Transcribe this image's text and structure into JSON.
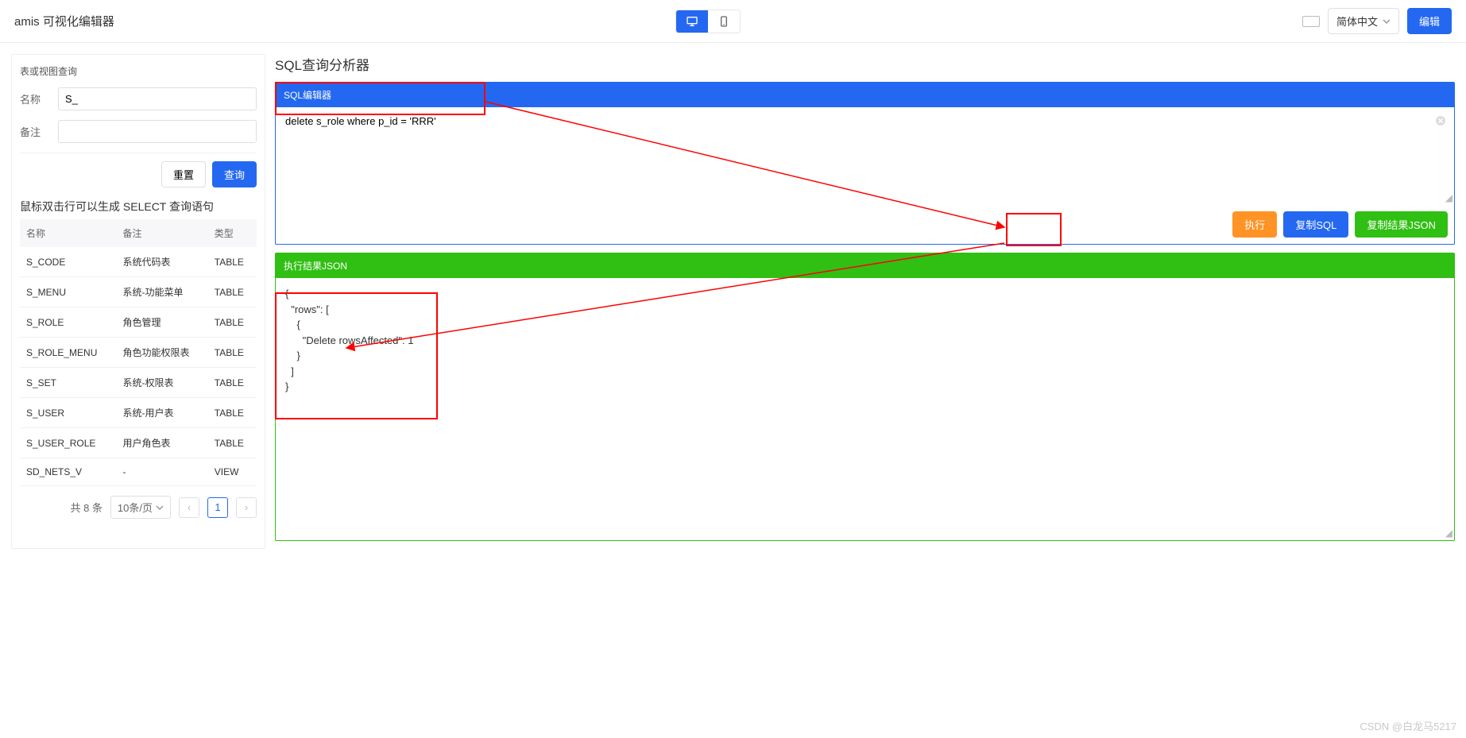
{
  "topbar": {
    "title": "amis 可视化编辑器",
    "lang": "简体中文",
    "edit": "编辑"
  },
  "sidebar": {
    "title": "表或视图查询",
    "name_label": "名称",
    "name_value": "S_",
    "remark_label": "备注",
    "remark_value": "",
    "reset": "重置",
    "query": "查询",
    "hint": "鼠标双击行可以生成 SELECT 查询语句",
    "cols": {
      "name": "名称",
      "remark": "备注",
      "type": "类型"
    },
    "rows": [
      {
        "name": "S_CODE",
        "remark": "系统代码表",
        "type": "TABLE"
      },
      {
        "name": "S_MENU",
        "remark": "系统-功能菜单",
        "type": "TABLE"
      },
      {
        "name": "S_ROLE",
        "remark": "角色管理",
        "type": "TABLE"
      },
      {
        "name": "S_ROLE_MENU",
        "remark": "角色功能权限表",
        "type": "TABLE"
      },
      {
        "name": "S_SET",
        "remark": "系统-权限表",
        "type": "TABLE"
      },
      {
        "name": "S_USER",
        "remark": "系统-用户表",
        "type": "TABLE"
      },
      {
        "name": "S_USER_ROLE",
        "remark": "用户角色表",
        "type": "TABLE"
      },
      {
        "name": "SD_NETS_V",
        "remark": "-",
        "type": "VIEW"
      }
    ],
    "pagination": {
      "total_label": "共 8 条",
      "page_size": "10条/页",
      "current": "1"
    }
  },
  "main": {
    "title": "SQL查询分析器",
    "editor_title": "SQL编辑器",
    "sql": "delete s_role where p_id = 'RRR'",
    "actions": {
      "run": "执行",
      "copy_sql": "复制SQL",
      "copy_json": "复制结果JSON"
    },
    "result_title": "执行结果JSON",
    "result_json": "{\n  \"rows\": [\n    {\n      \"Delete rowsAffected\": 1\n    }\n  ]\n}"
  },
  "watermark": "CSDN @白龙马5217"
}
